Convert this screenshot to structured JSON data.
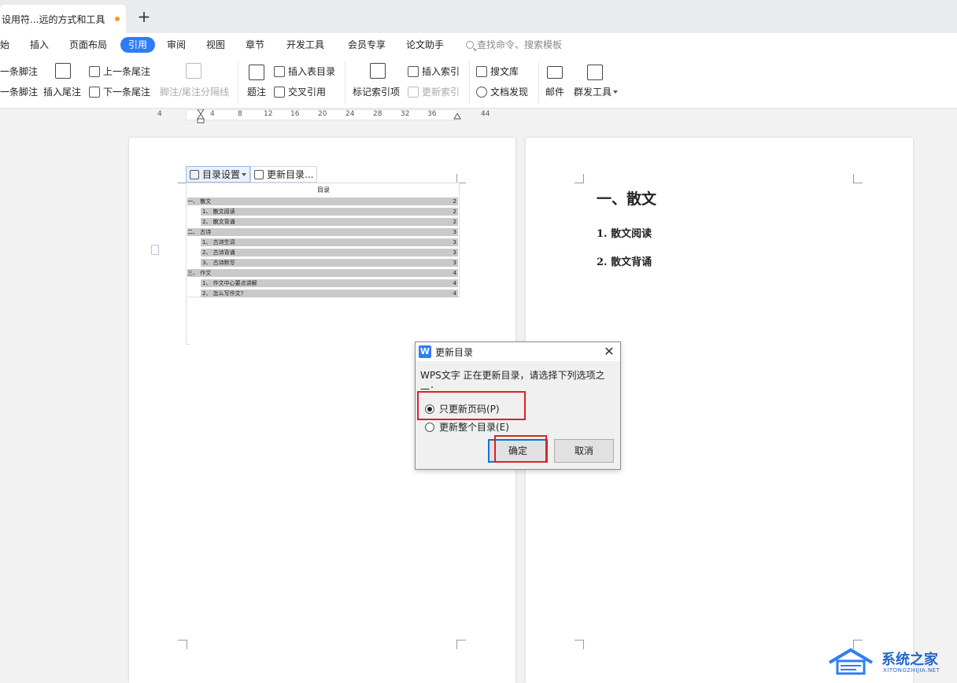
{
  "tab": {
    "title": "设用符...远的方式和工具",
    "add": "+"
  },
  "menu": {
    "items": [
      "始",
      "插入",
      "页面布局",
      "引用",
      "审阅",
      "视图",
      "章节",
      "开发工具",
      "会员专享",
      "论文助手"
    ],
    "active": "引用",
    "search_placeholder": "查找命令、搜索模板"
  },
  "ribbon": {
    "next_footnote": "一条脚注",
    "prev_footnote": "一条脚注",
    "insert_endnote": "插入尾注",
    "prev_endnote": "上一条尾注",
    "next_endnote": "下一条尾注",
    "separator": "脚注/尾注分隔线",
    "caption": "题注",
    "insert_table_toc": "插入表目录",
    "cross_ref": "交叉引用",
    "mark_index": "标记索引项",
    "insert_index": "插入索引",
    "update_index": "更新索引",
    "search_lib": "搜文库",
    "doc_discover": "文档发现",
    "mail": "邮件",
    "mass_tools": "群发工具"
  },
  "ruler": {
    "ticks": [
      "4",
      "4",
      "8",
      "12",
      "16",
      "20",
      "24",
      "28",
      "32",
      "36",
      "44"
    ]
  },
  "toc": {
    "settings_button": "目录设置",
    "update_button": "更新目录...",
    "title": "目录",
    "rows": [
      {
        "text": "一、 散文",
        "page": "2",
        "level": 1
      },
      {
        "text": "1、 散文阅读",
        "page": "2",
        "level": 2
      },
      {
        "text": "2、 散文背诵",
        "page": "2",
        "level": 2
      },
      {
        "text": "二、 古诗",
        "page": "3",
        "level": 1
      },
      {
        "text": "1、 古诗生词",
        "page": "3",
        "level": 2
      },
      {
        "text": "2、 古诗背诵",
        "page": "3",
        "level": 2
      },
      {
        "text": "3、 古诗默写",
        "page": "3",
        "level": 2
      },
      {
        "text": "三、 作文",
        "page": "4",
        "level": 1
      },
      {
        "text": "1、 作文中心要点讲解",
        "page": "4",
        "level": 2
      },
      {
        "text": "2、 怎么写作文?",
        "page": "4",
        "level": 2
      }
    ]
  },
  "right_page": {
    "heading": "一、散文",
    "sub1": "1. 散文阅读",
    "sub2": "2. 散文背诵"
  },
  "dialog": {
    "title": "更新目录",
    "message": "WPS文字 正在更新目录，请选择下列选项之一：",
    "option1": "只更新页码(P)",
    "option2": "更新整个目录(E)",
    "selected": "option1",
    "ok": "确定",
    "cancel": "取消",
    "highlight_color": "#e02020"
  },
  "watermark": {
    "cn": "系统之家",
    "en": "XITONGZHIJIA.NET"
  },
  "colors": {
    "accent": "#2d7cf6",
    "highlight": "#e02020",
    "toc_row": "#c9c9c9"
  }
}
